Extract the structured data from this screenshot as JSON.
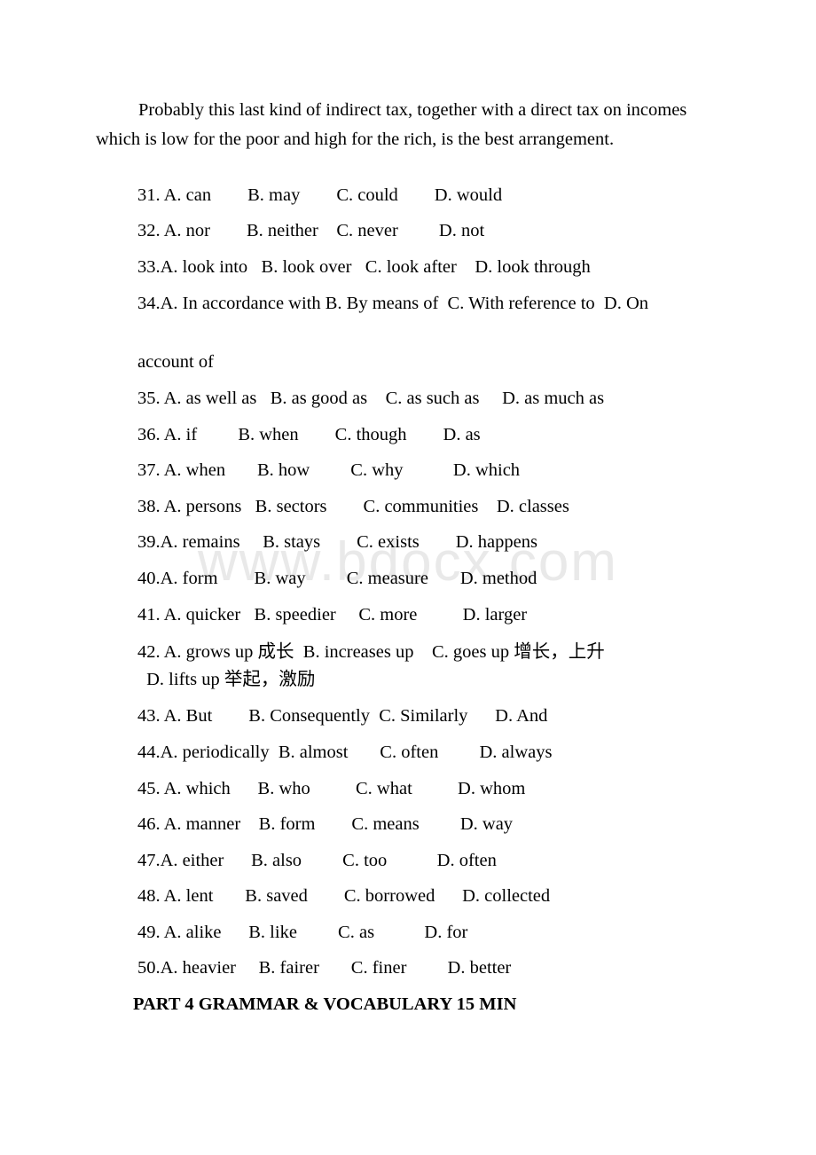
{
  "document": {
    "paragraph": "Probably this last kind of indirect tax, together with a direct tax on incomes which is low for the poor and high for the rich, is the best arrangement.",
    "watermark": "www.bdocx.com",
    "continuation_line": "account of",
    "part_heading": "PART 4 GRAMMAR & VOCABULARY 15 MIN",
    "questions": [
      {
        "number": "31.",
        "sep": " ",
        "text": "31. A. can        B. may        C. could        D. would"
      },
      {
        "number": "32.",
        "sep": " ",
        "text": "32. A. nor        B. neither    C. never         D. not"
      },
      {
        "number": "33.",
        "sep": "",
        "text": "33.A. look into   B. look over   C. look after    D. look through"
      },
      {
        "number": "34.",
        "sep": "",
        "text": "34.A. In accordance with B. By means of  C. With reference to  D. On"
      },
      {
        "number": "35.",
        "sep": " ",
        "text": "35. A. as well as   B. as good as    C. as such as     D. as much as"
      },
      {
        "number": "36.",
        "sep": " ",
        "text": "36. A. if         B. when        C. though        D. as"
      },
      {
        "number": "37.",
        "sep": " ",
        "text": "37. A. when       B. how         C. why           D. which"
      },
      {
        "number": "38.",
        "sep": " ",
        "text": "38. A. persons   B. sectors        C. communities    D. classes"
      },
      {
        "number": "39.",
        "sep": "",
        "text": "39.A. remains     B. stays        C. exists        D. happens"
      },
      {
        "number": "40.",
        "sep": "",
        "text": "40.A. form        B. way         C. measure       D. method"
      },
      {
        "number": "41.",
        "sep": " ",
        "text": "41. A. quicker   B. speedier     C. more          D. larger"
      },
      {
        "number": "43.",
        "sep": " ",
        "text": "43. A. But        B. Consequently  C. Similarly      D. And"
      },
      {
        "number": "44.",
        "sep": "",
        "text": "44.A. periodically  B. almost       C. often         D. always"
      },
      {
        "number": "45.",
        "sep": " ",
        "text": "45. A. which      B. who          C. what          D. whom"
      },
      {
        "number": "46.",
        "sep": " ",
        "text": "46. A. manner    B. form        C. means         D. way"
      },
      {
        "number": "47.",
        "sep": "",
        "text": "47.A. either      B. also         C. too           D. often"
      },
      {
        "number": "48.",
        "sep": " ",
        "text": "48. A. lent       B. saved        C. borrowed      D. collected"
      },
      {
        "number": "49.",
        "sep": " ",
        "text": "49. A. alike      B. like         C. as           D. for"
      },
      {
        "number": "50.",
        "sep": "",
        "text": "50.A. heavier     B. fairer       C. finer         D. better"
      }
    ],
    "question_42_line1": "42. A. grows up 成长  B. increases up    C. goes up 增长，上升",
    "question_42_line2": " D. lifts up 举起，激励"
  }
}
